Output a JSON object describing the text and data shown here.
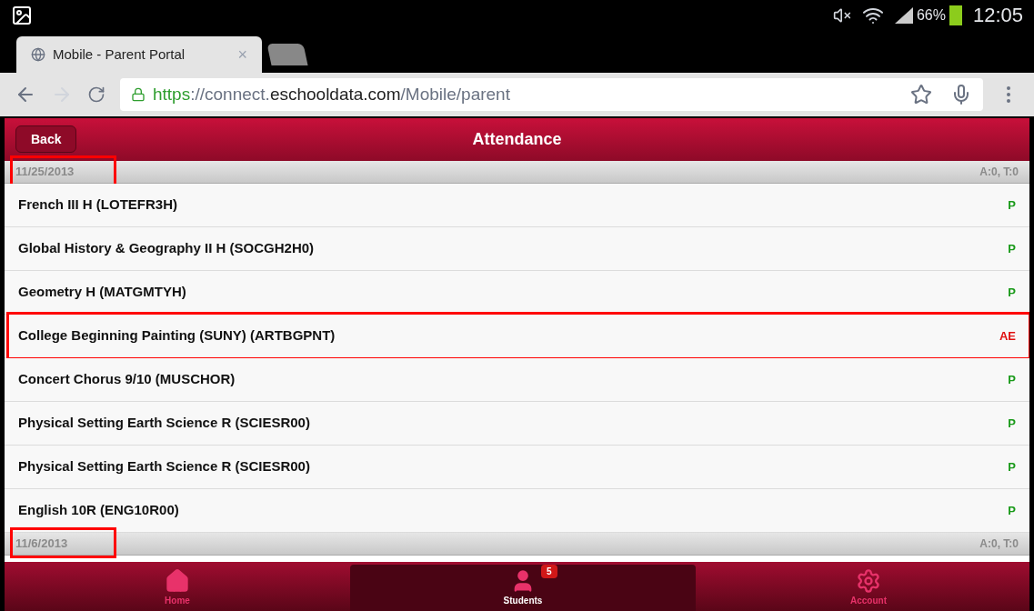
{
  "status_bar": {
    "battery": "66%",
    "time": "12:05"
  },
  "browser": {
    "tab_title": "Mobile - Parent Portal",
    "tab_close": "×",
    "url": {
      "scheme": "https",
      "sep": "://",
      "host_pre": "connect.",
      "host": "eschooldata.com",
      "path": "/Mobile/parent"
    }
  },
  "header": {
    "back": "Back",
    "title": "Attendance"
  },
  "groups": [
    {
      "date": "11/25/2013",
      "summary": "A:0, T:0",
      "highlighted": true,
      "rows": [
        {
          "course": "French III H (LOTEFR3H)",
          "status": "P",
          "color": "#1a9a1a",
          "highlighted": false
        },
        {
          "course": "Global History & Geography II H (SOCGH2H0)",
          "status": "P",
          "color": "#1a9a1a",
          "highlighted": false
        },
        {
          "course": "Geometry H (MATGMTYH)",
          "status": "P",
          "color": "#1a9a1a",
          "highlighted": false
        },
        {
          "course": "College Beginning Painting (SUNY) (ARTBGPNT)",
          "status": "AE",
          "color": "#e01010",
          "highlighted": true
        },
        {
          "course": "Concert Chorus 9/10 (MUSCHOR)",
          "status": "P",
          "color": "#1a9a1a",
          "highlighted": false
        },
        {
          "course": "Physical Setting Earth Science R (SCIESR00)",
          "status": "P",
          "color": "#1a9a1a",
          "highlighted": false
        },
        {
          "course": "Physical Setting Earth Science R (SCIESR00)",
          "status": "P",
          "color": "#1a9a1a",
          "highlighted": false
        },
        {
          "course": "English 10R (ENG10R00)",
          "status": "P",
          "color": "#1a9a1a",
          "highlighted": false
        }
      ]
    },
    {
      "date": "11/6/2013",
      "summary": "A:0, T:0",
      "highlighted": true
    }
  ],
  "nav": [
    {
      "kind": "home",
      "label": "Home",
      "selected": false
    },
    {
      "kind": "students",
      "label": "Students",
      "selected": true,
      "badge": "5"
    },
    {
      "kind": "account",
      "label": "Account",
      "selected": false
    }
  ]
}
